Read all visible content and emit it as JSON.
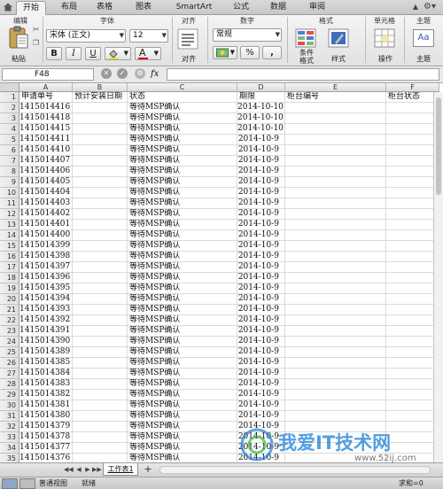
{
  "tabs": [
    {
      "label": "开始",
      "active": true
    },
    {
      "label": "布局"
    },
    {
      "label": "表格"
    },
    {
      "label": "图表"
    },
    {
      "label": "SmartArt"
    },
    {
      "label": "公式"
    },
    {
      "label": "数据"
    },
    {
      "label": "审阅"
    }
  ],
  "ribbon": {
    "groups": {
      "edit": "编辑",
      "font": "字体",
      "align": "对齐",
      "number": "数字",
      "format": "格式",
      "cells": "单元格",
      "theme": "主题"
    },
    "paste_label": "粘贴",
    "font_name": "宋体 (正文)",
    "font_size": "12",
    "bold": "B",
    "italic": "I",
    "underline": "U",
    "font_color_letter": "A",
    "align_label": "对齐",
    "number_format": "常规",
    "percent": "%",
    "comma": ",",
    "cond_format_label": "条件\n格式",
    "style_label": "样式",
    "cells_label": "操作",
    "theme_label": "主题",
    "theme_sample": "Aa"
  },
  "formula_bar": {
    "cell_ref": "F48",
    "fx": "fx",
    "value": ""
  },
  "columns": [
    "A",
    "B",
    "C",
    "D",
    "E",
    "F"
  ],
  "header_row": [
    "申请单号",
    "预计安装日期",
    "状态",
    "期限",
    "柜台编号",
    "柜台状态"
  ],
  "rows": [
    [
      "1415014416",
      "",
      "等待MSP确认",
      "2014-10-10"
    ],
    [
      "1415014418",
      "",
      "等待MSP确认",
      "2014-10-10"
    ],
    [
      "1415014415",
      "",
      "等待MSP确认",
      "2014-10-10"
    ],
    [
      "1415014411",
      "",
      "等待MSP确认",
      "2014-10-9"
    ],
    [
      "1415014410",
      "",
      "等待MSP确认",
      "2014-10-9"
    ],
    [
      "1415014407",
      "",
      "等待MSP确认",
      "2014-10-9"
    ],
    [
      "1415014406",
      "",
      "等待MSP确认",
      "2014-10-9"
    ],
    [
      "1415014405",
      "",
      "等待MSP确认",
      "2014-10-9"
    ],
    [
      "1415014404",
      "",
      "等待MSP确认",
      "2014-10-9"
    ],
    [
      "1415014403",
      "",
      "等待MSP确认",
      "2014-10-9"
    ],
    [
      "1415014402",
      "",
      "等待MSP确认",
      "2014-10-9"
    ],
    [
      "1415014401",
      "",
      "等待MSP确认",
      "2014-10-9"
    ],
    [
      "1415014400",
      "",
      "等待MSP确认",
      "2014-10-9"
    ],
    [
      "1415014399",
      "",
      "等待MSP确认",
      "2014-10-9"
    ],
    [
      "1415014398",
      "",
      "等待MSP确认",
      "2014-10-9"
    ],
    [
      "1415014397",
      "",
      "等待MSP确认",
      "2014-10-9"
    ],
    [
      "1415014396",
      "",
      "等待MSP确认",
      "2014-10-9"
    ],
    [
      "1415014395",
      "",
      "等待MSP确认",
      "2014-10-9"
    ],
    [
      "1415014394",
      "",
      "等待MSP确认",
      "2014-10-9"
    ],
    [
      "1415014393",
      "",
      "等待MSP确认",
      "2014-10-9"
    ],
    [
      "1415014392",
      "",
      "等待MSP确认",
      "2014-10-9"
    ],
    [
      "1415014391",
      "",
      "等待MSP确认",
      "2014-10-9"
    ],
    [
      "1415014390",
      "",
      "等待MSP确认",
      "2014-10-9"
    ],
    [
      "1415014389",
      "",
      "等待MSP确认",
      "2014-10-9"
    ],
    [
      "1415014385",
      "",
      "等待MSP确认",
      "2014-10-9"
    ],
    [
      "1415014384",
      "",
      "等待MSP确认",
      "2014-10-9"
    ],
    [
      "1415014383",
      "",
      "等待MSP确认",
      "2014-10-9"
    ],
    [
      "1415014382",
      "",
      "等待MSP确认",
      "2014-10-9"
    ],
    [
      "1415014381",
      "",
      "等待MSP确认",
      "2014-10-9"
    ],
    [
      "1415014380",
      "",
      "等待MSP确认",
      "2014-10-9"
    ],
    [
      "1415014379",
      "",
      "等待MSP确认",
      "2014-10-9"
    ],
    [
      "1415014378",
      "",
      "等待MSP确认",
      "2014-10-9"
    ],
    [
      "1415014377",
      "",
      "等待MSP确认",
      "2014-10-9"
    ],
    [
      "1415014376",
      "",
      "等待MSP确认",
      "2014-10-9"
    ]
  ],
  "sheet_tab": "工作表1",
  "status": {
    "view": "普通视图",
    "ready": "就绪",
    "sum": "求和=0"
  },
  "watermark": {
    "text": "我爱IT技术网",
    "url": "www.52ij.com"
  },
  "colors": {
    "accent_green": "#2f7d2f",
    "font_color_bar": "#d40000",
    "fill_color_bar": "#f5e000"
  }
}
